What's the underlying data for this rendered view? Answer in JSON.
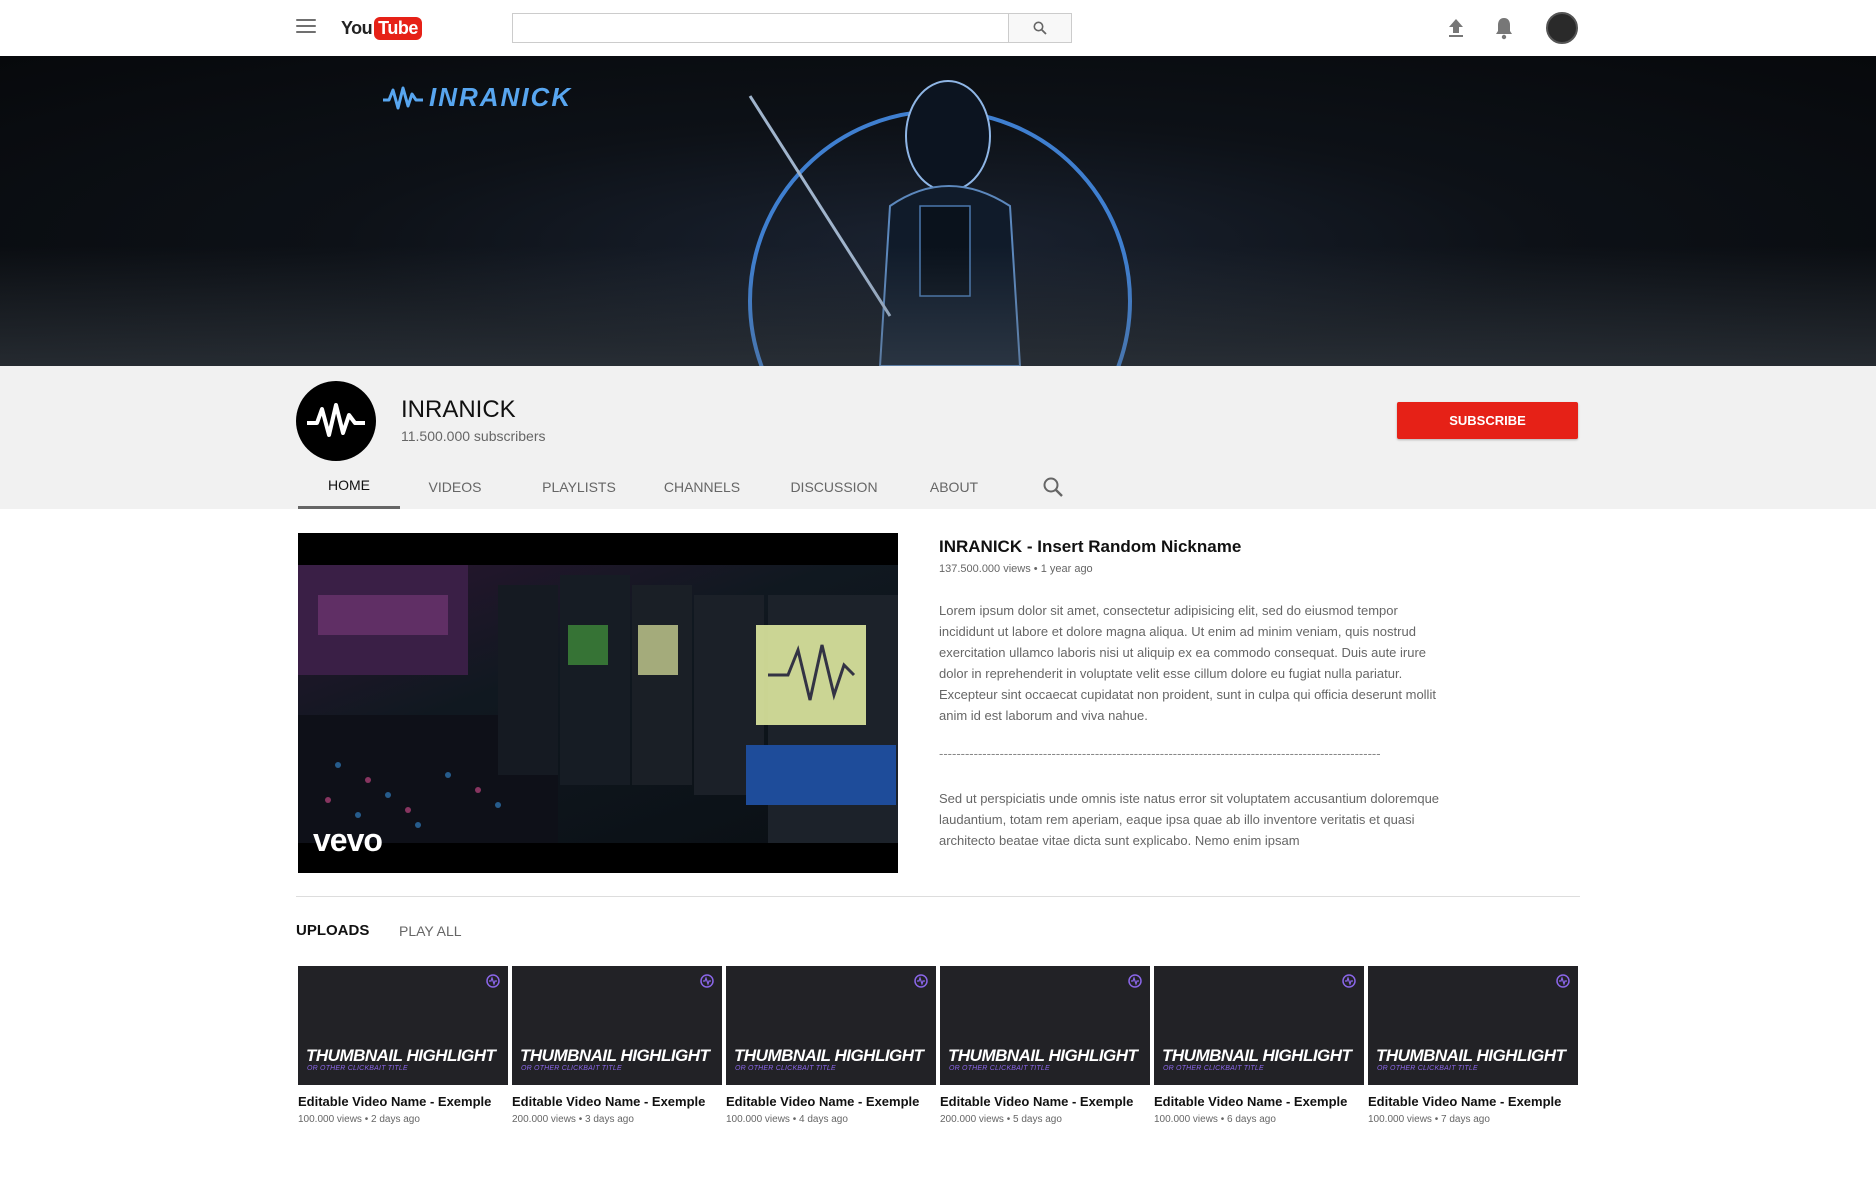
{
  "header": {
    "logo_you": "You",
    "logo_tube": "Tube",
    "search_placeholder": ""
  },
  "banner": {
    "logo_text": "INRANICK"
  },
  "channel": {
    "name": "INRANICK",
    "subscribers": "11.500.000 subscribers",
    "subscribe_label": "SUBSCRIBE",
    "tabs": [
      {
        "label": "HOME",
        "active": true
      },
      {
        "label": "VIDEOS",
        "active": false
      },
      {
        "label": "PLAYLISTS",
        "active": false
      },
      {
        "label": "CHANNELS",
        "active": false
      },
      {
        "label": "DISCUSSION",
        "active": false
      },
      {
        "label": "ABOUT",
        "active": false
      }
    ]
  },
  "featured": {
    "watermark": "vevo",
    "title": "INRANICK - Insert Random Nickname",
    "meta": "137.500.000 views • 1 year ago",
    "description": "Lorem ipsum dolor sit amet, consectetur adipisicing elit, sed do eiusmod tempor incididunt ut labore et dolore magna aliqua. Ut enim ad minim veniam, quis nostrud exercitation ullamco laboris nisi ut aliquip ex ea commodo consequat. Duis aute irure dolor in reprehenderit in voluptate velit esse cillum dolore eu fugiat nulla pariatur. Excepteur sint occaecat cupidatat non proident, sunt in culpa qui officia deserunt mollit anim id est laborum and viva nahue.",
    "divider": "------------------------------------------------------------------------------------------------------",
    "description2": "Sed ut perspiciatis unde omnis iste natus error sit voluptatem accusantium doloremque laudantium, totam rem aperiam, eaque ipsa quae ab illo inventore veritatis et quasi architecto beatae vitae dicta sunt explicabo. Nemo enim ipsam"
  },
  "uploads": {
    "title": "UPLOADS",
    "play_all": "PLAY ALL",
    "videos": [
      {
        "thumb_highlight": "THUMBNAIL HIGHLIGHT",
        "thumb_sub": "OR OTHER CLICKBAIT TITLE",
        "title": "Editable Video Name - Exemple",
        "meta": "100.000 views • 2 days ago"
      },
      {
        "thumb_highlight": "THUMBNAIL HIGHLIGHT",
        "thumb_sub": "OR OTHER CLICKBAIT TITLE",
        "title": "Editable Video Name - Exemple",
        "meta": "200.000 views • 3 days ago"
      },
      {
        "thumb_highlight": "THUMBNAIL HIGHLIGHT",
        "thumb_sub": "OR OTHER CLICKBAIT TITLE",
        "title": "Editable Video Name - Exemple",
        "meta": "100.000 views • 4 days ago"
      },
      {
        "thumb_highlight": "THUMBNAIL HIGHLIGHT",
        "thumb_sub": "OR OTHER CLICKBAIT TITLE",
        "title": "Editable Video Name - Exemple",
        "meta": "200.000 views • 5 days ago"
      },
      {
        "thumb_highlight": "THUMBNAIL HIGHLIGHT",
        "thumb_sub": "OR OTHER CLICKBAIT TITLE",
        "title": "Editable Video Name - Exemple",
        "meta": "100.000 views • 6 days ago"
      },
      {
        "thumb_highlight": "THUMBNAIL HIGHLIGHT",
        "thumb_sub": "OR OTHER CLICKBAIT TITLE",
        "title": "Editable Video Name - Exemple",
        "meta": "100.000 views • 7 days ago"
      }
    ]
  },
  "icons": {
    "menu": "hamburger-menu-icon",
    "search": "search-icon",
    "upload": "upload-icon",
    "notifications": "bell-icon",
    "account": "avatar-icon",
    "channel_logo": "waveform-logo-icon"
  },
  "colors": {
    "brand_red": "#e62117",
    "banner_blue": "#58a6f0",
    "thumb_accent": "#8a66e8"
  }
}
